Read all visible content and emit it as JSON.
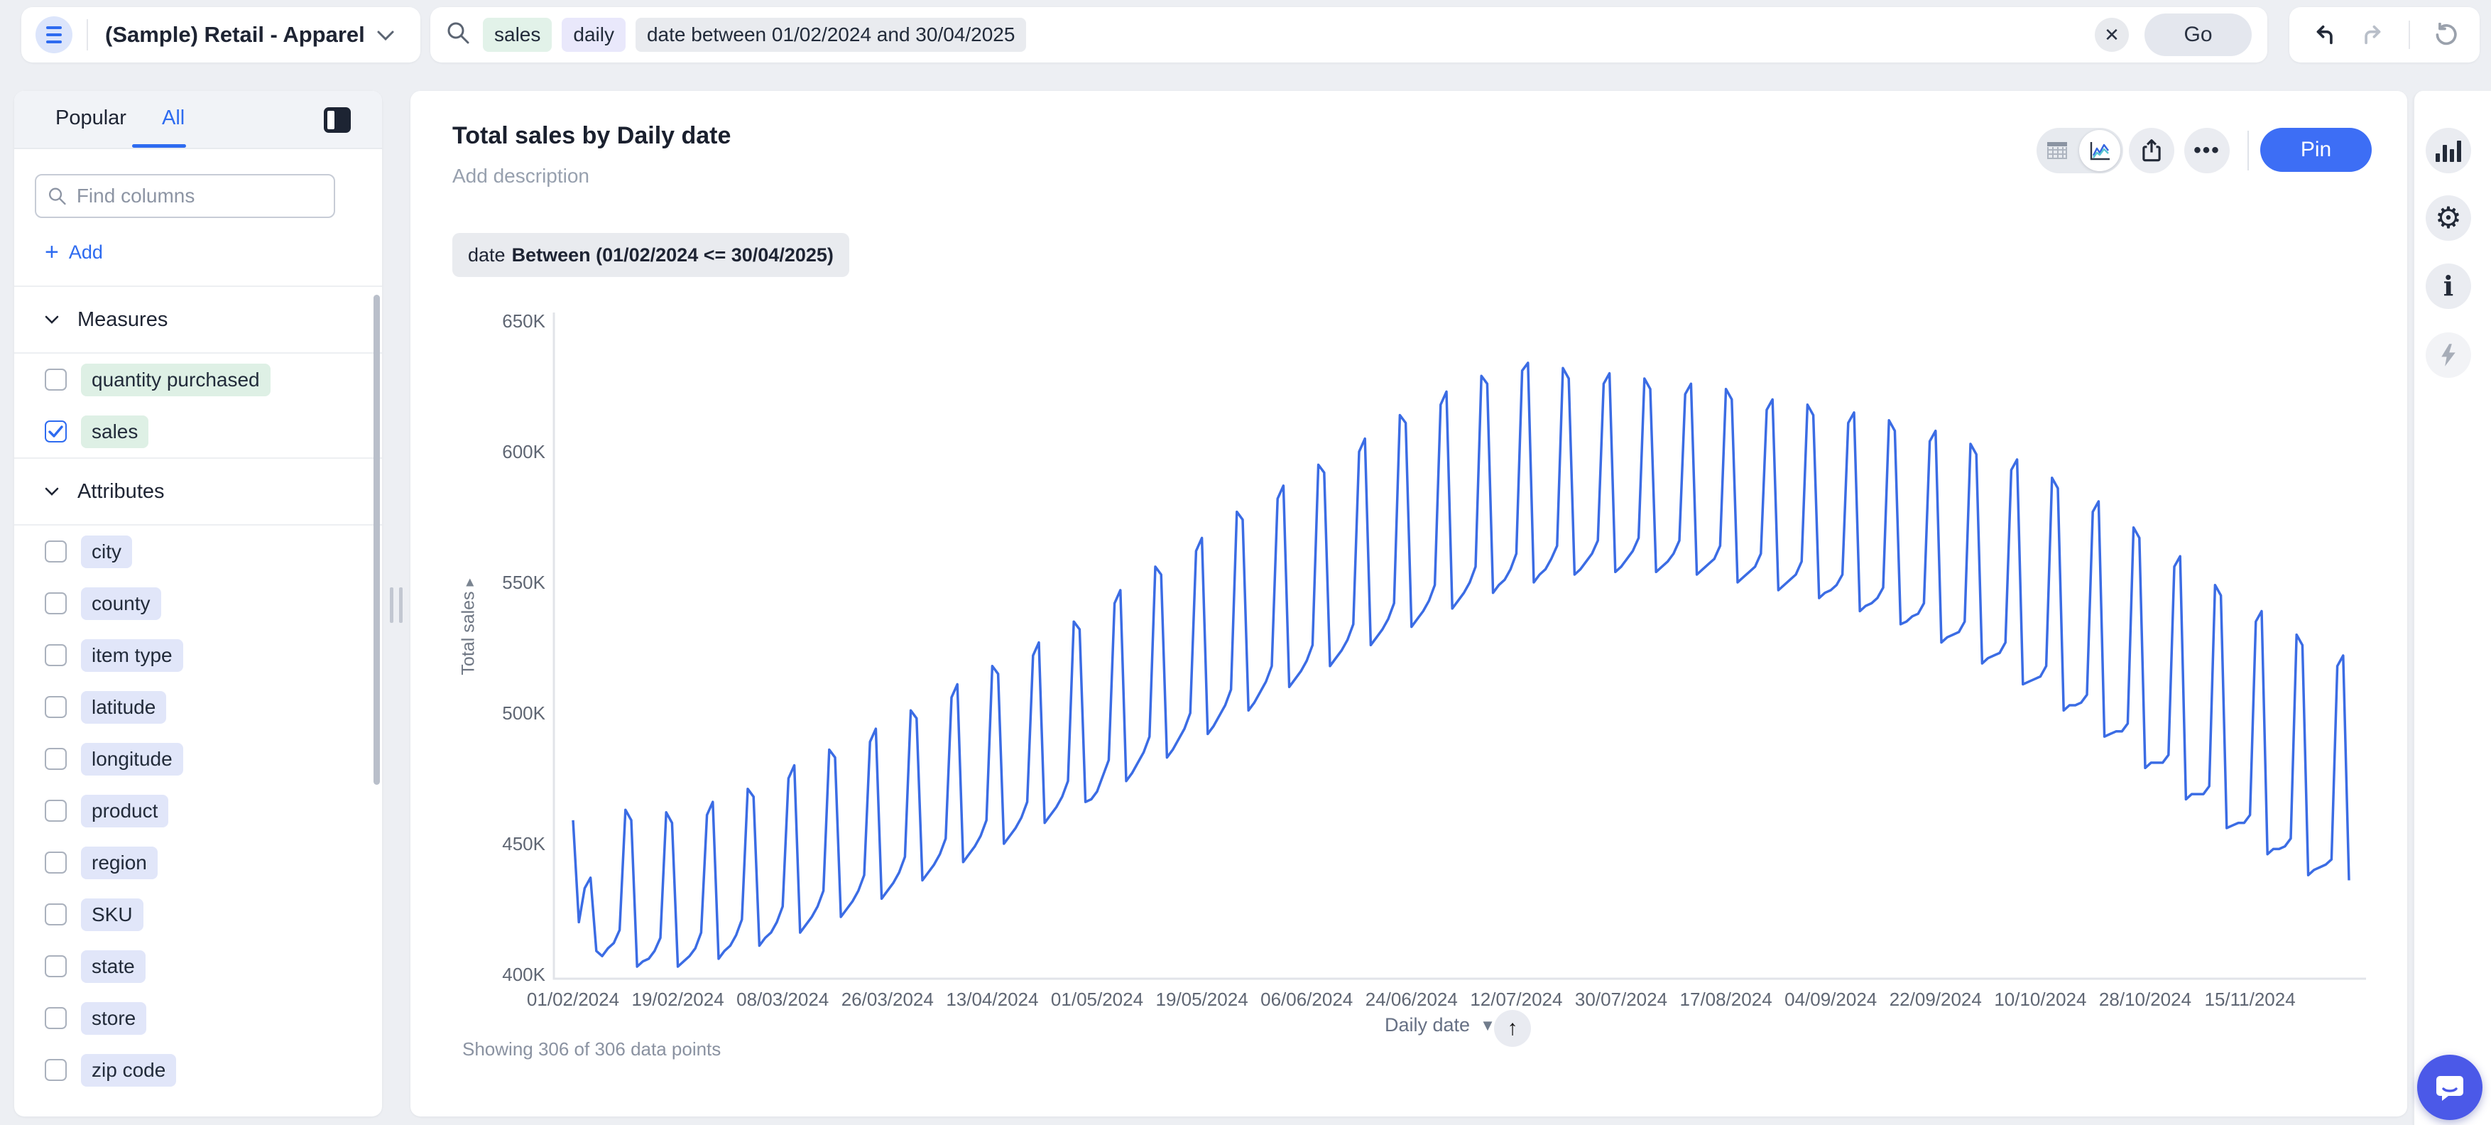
{
  "topbar": {
    "datasource": "(Sample) Retail - Apparel",
    "tokens": [
      {
        "text": "sales",
        "type": "measure"
      },
      {
        "text": "daily",
        "type": "keyword"
      },
      {
        "text": "date between 01/02/2024 and 30/04/2025",
        "type": "filter"
      }
    ],
    "clear_label": "✕",
    "go_label": "Go"
  },
  "sidebar": {
    "tabs": [
      "Popular",
      "All"
    ],
    "active_tab": "All",
    "search_placeholder": "Find columns",
    "add_label": "Add",
    "sections": [
      {
        "title": "Measures",
        "kind": "measure",
        "items": [
          {
            "label": "quantity purchased",
            "checked": false
          },
          {
            "label": "sales",
            "checked": true
          }
        ]
      },
      {
        "title": "Attributes",
        "kind": "attribute",
        "items": [
          {
            "label": "city",
            "checked": false
          },
          {
            "label": "county",
            "checked": false
          },
          {
            "label": "item type",
            "checked": false
          },
          {
            "label": "latitude",
            "checked": false
          },
          {
            "label": "longitude",
            "checked": false
          },
          {
            "label": "product",
            "checked": false
          },
          {
            "label": "region",
            "checked": false
          },
          {
            "label": "SKU",
            "checked": false
          },
          {
            "label": "state",
            "checked": false
          },
          {
            "label": "store",
            "checked": false
          },
          {
            "label": "zip code",
            "checked": false
          }
        ]
      }
    ]
  },
  "main": {
    "title": "Total sales by Daily date",
    "description_placeholder": "Add description",
    "filter_chip": {
      "field": "date",
      "condition": "Between (01/02/2024 <= 30/04/2025)"
    },
    "pin_label": "Pin",
    "footer": {
      "showing": "Showing 306 of 306 data points",
      "x_field": "Daily date"
    }
  },
  "chart_data": {
    "type": "line",
    "title": "Total sales by Daily date",
    "xlabel": "Daily date",
    "ylabel": "Total sales",
    "series_name": "Total sales",
    "ylim": [
      400000,
      650000
    ],
    "y_tick_labels": [
      "650K",
      "600K",
      "550K",
      "500K",
      "450K",
      "400K"
    ],
    "y_tick_values_k": [
      650,
      600,
      550,
      500,
      450,
      400
    ],
    "x_tick_labels": [
      "01/02/2024",
      "19/02/2024",
      "08/03/2024",
      "26/03/2024",
      "13/04/2024",
      "01/05/2024",
      "19/05/2024",
      "06/06/2024",
      "24/06/2024",
      "12/07/2024",
      "30/07/2024",
      "17/08/2024",
      "04/09/2024",
      "22/09/2024",
      "10/10/2024",
      "28/10/2024",
      "15/11/2024"
    ],
    "x_tick_interval_days": 18,
    "start_date": "01/02/2024",
    "points_shown": 306,
    "points_total": 306,
    "values_unit": "thousands",
    "values_k": [
      459,
      420,
      433,
      437,
      409,
      407,
      410,
      412,
      417,
      463,
      459,
      403,
      405,
      406,
      409,
      414,
      462,
      458,
      403,
      405,
      407,
      410,
      416,
      461,
      466,
      406,
      409,
      411,
      415,
      421,
      471,
      468,
      411,
      414,
      416,
      420,
      426,
      475,
      480,
      416,
      419,
      422,
      426,
      432,
      486,
      483,
      422,
      425,
      428,
      432,
      438,
      489,
      494,
      429,
      432,
      435,
      439,
      445,
      501,
      498,
      436,
      439,
      442,
      446,
      452,
      506,
      511,
      443,
      446,
      449,
      453,
      459,
      518,
      515,
      450,
      453,
      456,
      460,
      466,
      522,
      527,
      458,
      461,
      464,
      468,
      474,
      535,
      532,
      466,
      467,
      470,
      476,
      482,
      542,
      547,
      474,
      477,
      481,
      485,
      491,
      556,
      553,
      483,
      486,
      490,
      494,
      500,
      562,
      567,
      492,
      495,
      499,
      503,
      509,
      577,
      574,
      501,
      504,
      508,
      512,
      518,
      582,
      587,
      510,
      513,
      516,
      520,
      526,
      595,
      592,
      518,
      521,
      524,
      528,
      534,
      600,
      605,
      526,
      529,
      532,
      536,
      542,
      614,
      611,
      533,
      536,
      539,
      543,
      549,
      618,
      623,
      540,
      543,
      546,
      550,
      556,
      629,
      626,
      546,
      549,
      551,
      555,
      561,
      631,
      634,
      550,
      553,
      555,
      559,
      564,
      632,
      628,
      553,
      555,
      558,
      561,
      566,
      626,
      630,
      554,
      556,
      559,
      562,
      567,
      628,
      624,
      554,
      556,
      558,
      561,
      566,
      622,
      626,
      553,
      555,
      557,
      559,
      564,
      624,
      620,
      550,
      552,
      554,
      556,
      561,
      616,
      620,
      547,
      549,
      551,
      553,
      558,
      618,
      614,
      544,
      546,
      547,
      549,
      553,
      611,
      615,
      539,
      541,
      542,
      544,
      548,
      612,
      608,
      534,
      535,
      537,
      538,
      542,
      604,
      608,
      527,
      529,
      530,
      531,
      535,
      603,
      599,
      519,
      521,
      522,
      523,
      527,
      593,
      597,
      511,
      512,
      513,
      514,
      518,
      590,
      586,
      501,
      503,
      503,
      504,
      507,
      577,
      581,
      491,
      492,
      493,
      493,
      496,
      571,
      567,
      479,
      481,
      481,
      481,
      484,
      556,
      560,
      467,
      469,
      469,
      469,
      472,
      549,
      545,
      456,
      457,
      458,
      458,
      461,
      535,
      539,
      446,
      448,
      448,
      449,
      452,
      530,
      526,
      438,
      440,
      441,
      442,
      444,
      518,
      522,
      436
    ],
    "grid": false,
    "legend": "none"
  },
  "colors": {
    "accent": "#2e6bf0",
    "pin_button": "#3d6ef5",
    "line": "#3b6ce4",
    "token_green": "#e2f2e9",
    "token_lavender": "#e9e8fb",
    "chip_gray": "#e9ebef",
    "pill_green": "#def0e5",
    "pill_lavender": "#e1e6f9",
    "chat_bubble": "#4b59e8"
  }
}
